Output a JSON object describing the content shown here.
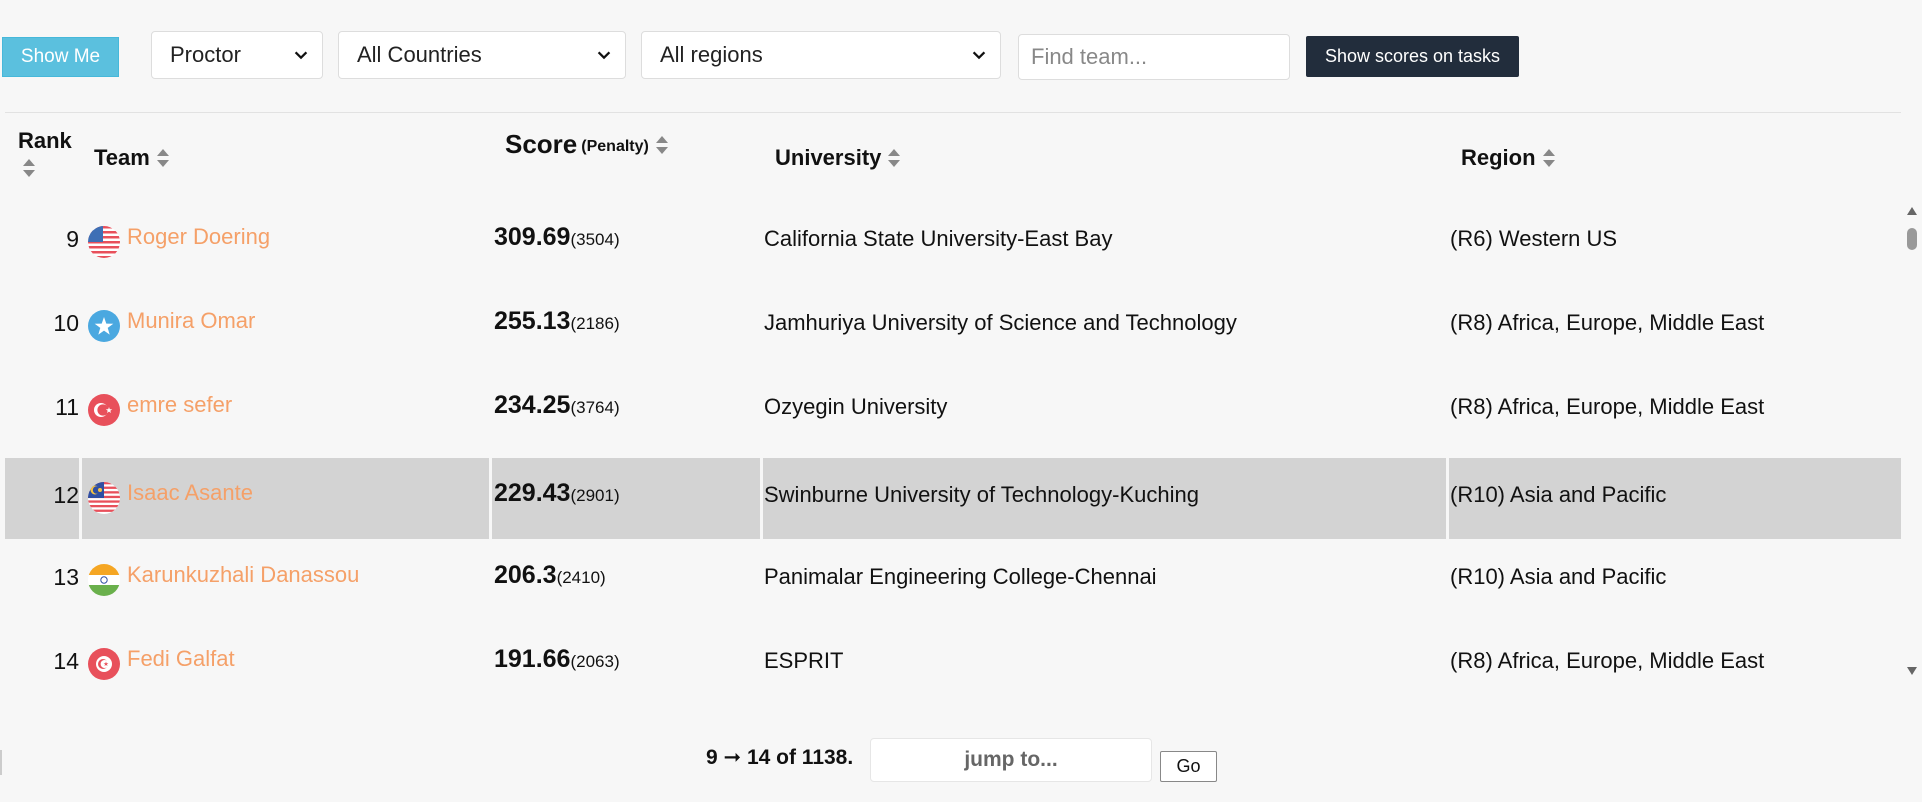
{
  "toolbar": {
    "show_me_label": "Show Me",
    "role_select": "Proctor",
    "country_select": "All Countries",
    "region_select": "All regions",
    "find_placeholder": "Find team...",
    "show_scores_label": "Show scores on tasks"
  },
  "table": {
    "headers": {
      "rank": "Rank",
      "team": "Team",
      "score": "Score",
      "penalty": "(Penalty)",
      "university": "University",
      "region": "Region"
    },
    "rows": [
      {
        "rank": "9",
        "flag": "flag-usa-icon",
        "team": "Roger Doering",
        "score": "309.69",
        "penalty": "(3504)",
        "university": "California State University-East Bay",
        "region": "(R6) Western US"
      },
      {
        "rank": "10",
        "flag": "flag-somalia-icon",
        "team": "Munira Omar",
        "score": "255.13",
        "penalty": "(2186)",
        "university": "Jamhuriya University of Science and Technology",
        "region": "(R8) Africa, Europe, Middle East"
      },
      {
        "rank": "11",
        "flag": "flag-turkey-icon",
        "team": "emre sefer",
        "score": "234.25",
        "penalty": "(3764)",
        "university": "Ozyegin University",
        "region": "(R8) Africa, Europe, Middle East"
      },
      {
        "rank": "12",
        "flag": "flag-malaysia-icon",
        "team": "Isaac Asante",
        "score": "229.43",
        "penalty": "(2901)",
        "university": "Swinburne University of Technology-Kuching",
        "region": "(R10) Asia and Pacific"
      },
      {
        "rank": "13",
        "flag": "flag-india-icon",
        "team": "Karunkuzhali Danassou",
        "score": "206.3",
        "penalty": "(2410)",
        "university": "Panimalar Engineering College-Chennai",
        "region": "(R10) Asia and Pacific"
      },
      {
        "rank": "14",
        "flag": "flag-tunisia-icon",
        "team": "Fedi Galfat",
        "score": "191.66",
        "penalty": "(2063)",
        "university": "ESPRIT",
        "region": "(R8) Africa, Europe, Middle East"
      }
    ]
  },
  "pager": {
    "info": "9 ➞ 14 of 1138.",
    "jump_placeholder": "jump to...",
    "go_label": "Go"
  },
  "colors": {
    "accent_team": "#f5a068",
    "show_me_bg": "#5bc0de",
    "scores_btn_bg": "#222d3c",
    "highlight_row": "#d3d3d3"
  }
}
